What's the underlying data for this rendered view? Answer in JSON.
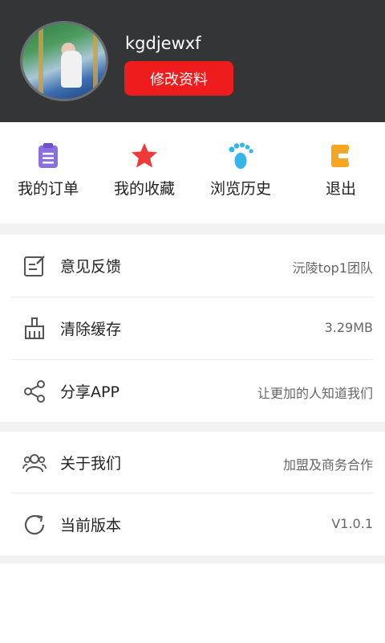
{
  "profile": {
    "username": "kgdjewxf",
    "edit_label": "修改资料"
  },
  "quick_actions": [
    {
      "label": "我的订单",
      "icon": "order-list-icon",
      "color": "#8b6fe0"
    },
    {
      "label": "我的收藏",
      "icon": "star-icon",
      "color": "#f03a3a"
    },
    {
      "label": "浏览历史",
      "icon": "footprint-icon",
      "color": "#36b5ea"
    },
    {
      "label": "退出",
      "icon": "exit-icon",
      "color": "#f5a623"
    }
  ],
  "menu_group_1": [
    {
      "title": "意见反馈",
      "value": "沅陵top1团队",
      "icon": "feedback-icon"
    },
    {
      "title": "清除缓存",
      "value": "3.29MB",
      "icon": "broom-icon"
    },
    {
      "title": "分享APP",
      "value": "让更加的人知道我们",
      "icon": "share-icon"
    }
  ],
  "menu_group_2": [
    {
      "title": "关于我们",
      "value": "加盟及商务合作",
      "icon": "users-icon"
    },
    {
      "title": "当前版本",
      "value": "V1.0.1",
      "icon": "refresh-icon"
    }
  ],
  "colors": {
    "header_bg": "#333537",
    "accent": "#ee1c1c",
    "separator": "#f2f2f2"
  }
}
